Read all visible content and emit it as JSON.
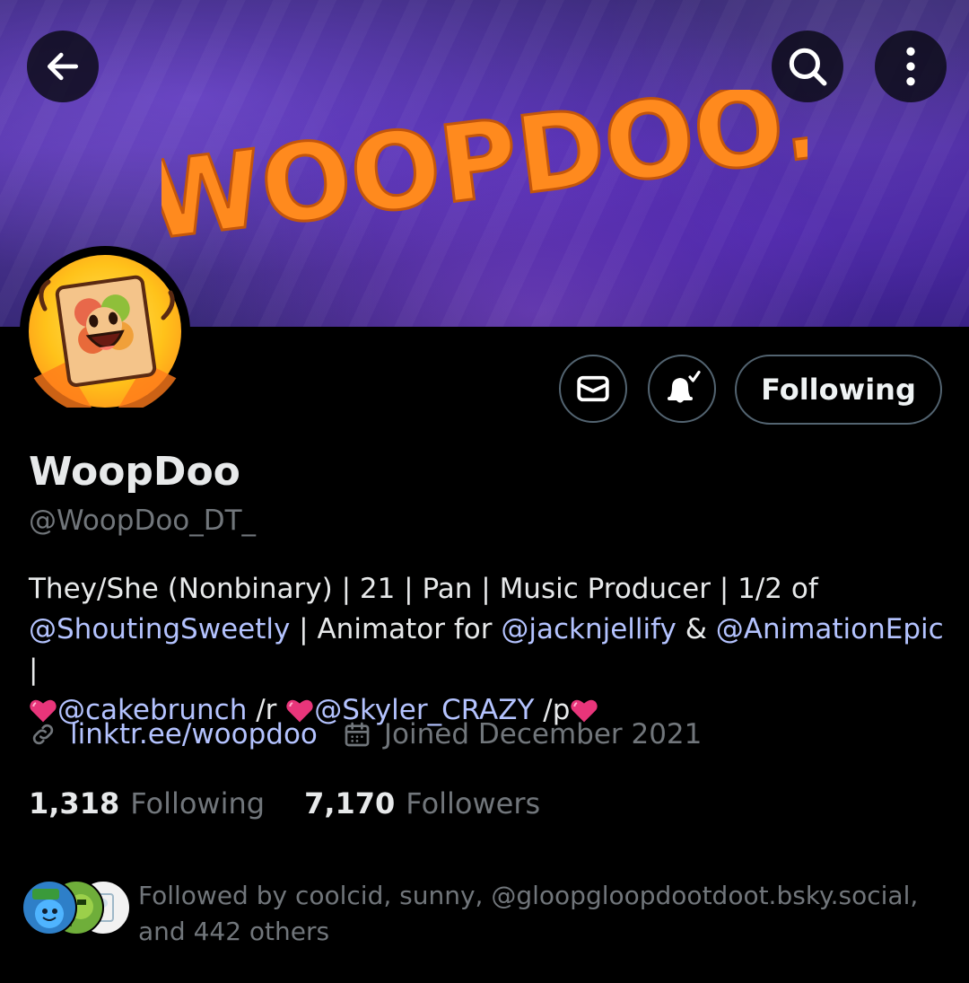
{
  "banner": {
    "logo_text": "WOOPDOO."
  },
  "top_bar": {
    "back_icon": "arrow-left-icon",
    "search_icon": "search-icon",
    "more_icon": "more-vertical-icon"
  },
  "actions": {
    "message_icon": "envelope-icon",
    "notify_icon": "bell-check-icon",
    "follow_label": "Following"
  },
  "profile": {
    "display_name": "WoopDoo",
    "handle": "@WoopDoo_DT_",
    "bio": {
      "line1": "They/She (Nonbinary) | 21 | Pan | Music Producer | 1/2 of",
      "mention1": "@ShoutingSweetly",
      "text2": " | Animator for ",
      "mention2": "@jacknjellify",
      "text3": " & ",
      "mention3": "@AnimationEpic",
      "text4": " |",
      "mention4": "@cakebrunch",
      "text5": " /r ",
      "mention5": "@Skyler_CRAZY",
      "text6": " /p"
    },
    "link": "linktr.ee/woopdoo",
    "joined": "Joined December 2021"
  },
  "stats": {
    "following_count": "1,318",
    "following_label": "Following",
    "followers_count": "7,170",
    "followers_label": "Followers"
  },
  "followed_by": {
    "text": "Followed by coolcid, sunny, @gloopgloopdootdoot.bsky.social, and 442 others"
  },
  "colors": {
    "accent_link": "#b4c3ff",
    "muted": "#71767b",
    "banner_purple": "#4a2c9a",
    "logo_orange": "#ff8a1e",
    "heart_pink": "#e8357a"
  }
}
